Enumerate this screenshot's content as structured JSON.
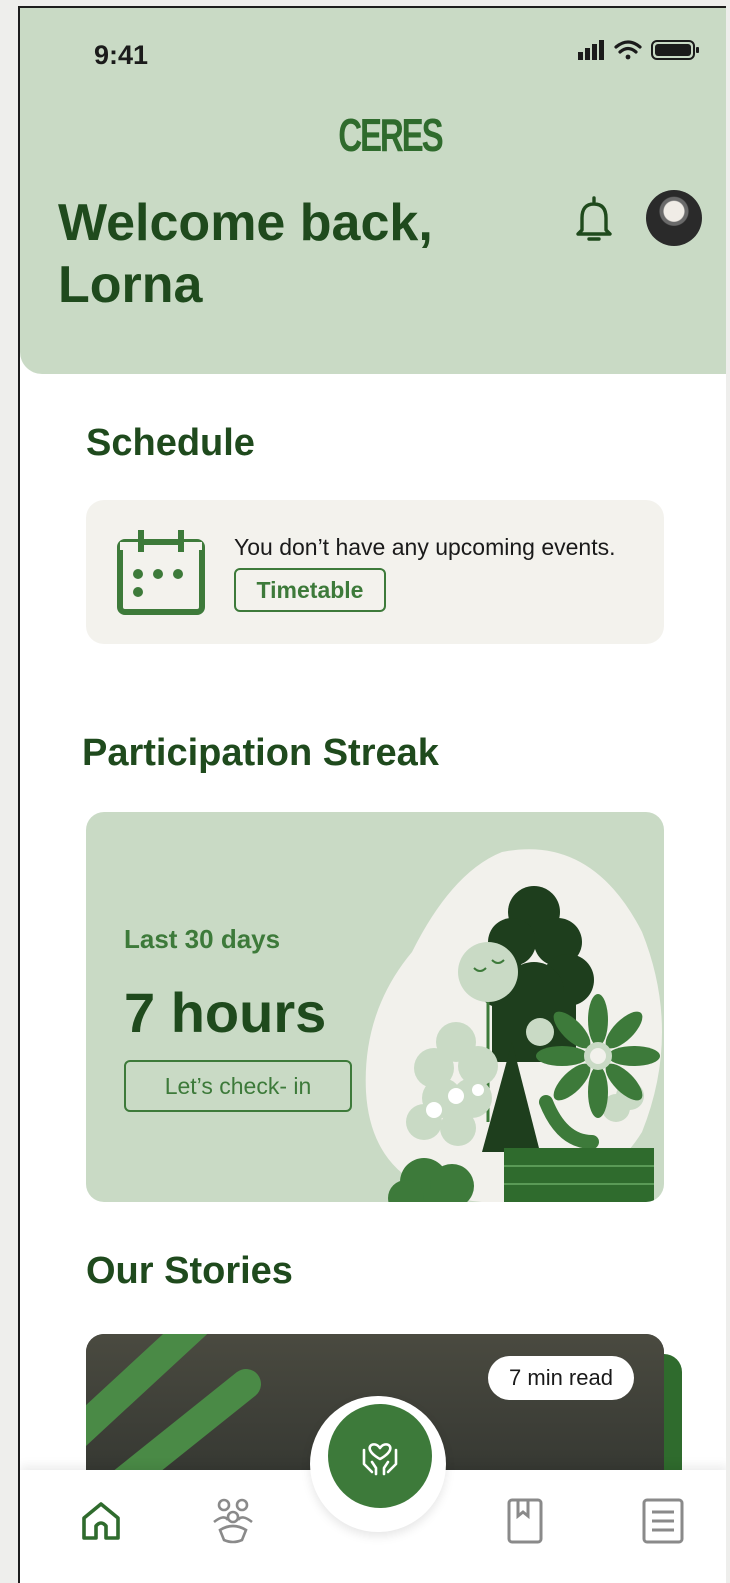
{
  "status_bar": {
    "time": "9:41",
    "signal_icon": "signal-icon",
    "wifi_icon": "wifi-icon",
    "battery_icon": "battery-icon"
  },
  "header": {
    "logo": "CERES",
    "welcome_line1": "Welcome back,",
    "welcome_line2": "Lorna",
    "bell_icon": "bell-icon",
    "avatar_icon": "avatar"
  },
  "schedule": {
    "title": "Schedule",
    "empty_text": "You don’t have any upcoming events.",
    "button_label": "Timetable",
    "icon": "calendar-icon"
  },
  "streak": {
    "title": "Participation Streak",
    "period_label": "Last 30 days",
    "value": "7 hours",
    "button_label": "Let’s check- in"
  },
  "stories": {
    "title": "Our Stories",
    "badge": "7 min read"
  },
  "bottom_nav": {
    "items": [
      "home-icon",
      "community-icon",
      "care-hands-icon",
      "bookmark-icon",
      "document-icon"
    ]
  },
  "colors": {
    "header_bg": "#c9dac5",
    "primary_dark": "#1f4a1d",
    "accent": "#3d7a3a",
    "card_bg": "#f3f2ed"
  }
}
